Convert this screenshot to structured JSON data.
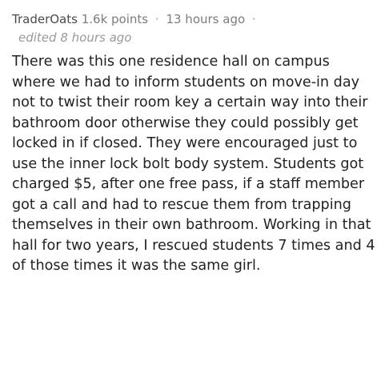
{
  "comment": {
    "author": "TraderOats",
    "points": "1.6k points",
    "separator": "·",
    "time": "13 hours ago",
    "trailing_separator": "·",
    "edited": "edited 8 hours ago",
    "body": "There was this one residence hall on campus where we had to inform students on move-in day not to twist their room key a certain way into their bathroom door otherwise they could possibly get locked in if closed. They were encouraged just to use the inner lock bolt body system. Students got charged $5, after one free pass, if a staff member got a call and had to rescue them from trapping themselves in their own bathroom. Working in that hall for two years, I rescued students 7 times and 4 of those times it was the same girl."
  }
}
